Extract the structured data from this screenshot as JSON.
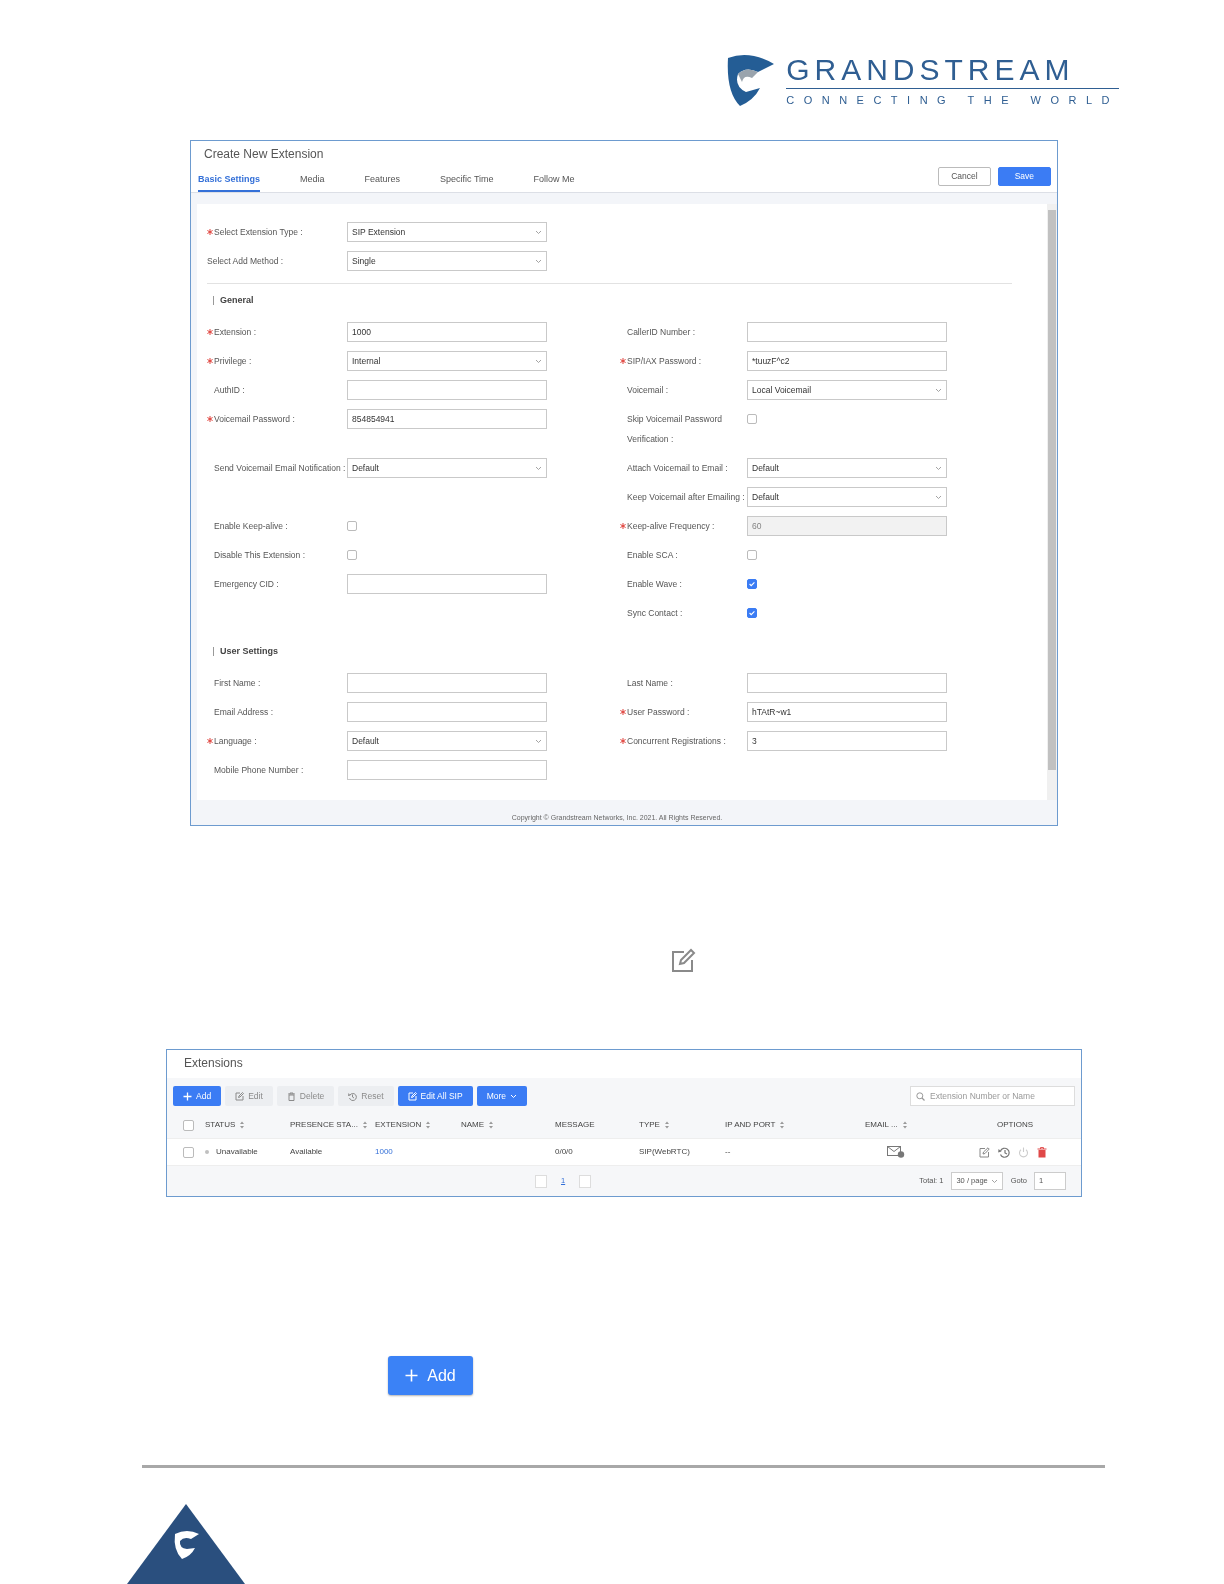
{
  "brand": {
    "name": "GRANDSTREAM",
    "tagline": "CONNECTING THE WORLD"
  },
  "form": {
    "title": "Create New Extension",
    "tabs": [
      {
        "label": "Basic Settings",
        "selected": true
      },
      {
        "label": "Media",
        "selected": false
      },
      {
        "label": "Features",
        "selected": false
      },
      {
        "label": "Specific Time",
        "selected": false
      },
      {
        "label": "Follow Me",
        "selected": false
      }
    ],
    "cancel": "Cancel",
    "save": "Save",
    "top_fields": [
      {
        "label": "Select Extension Type :",
        "required": true,
        "kind": "select",
        "value": "SIP Extension"
      },
      {
        "label": "Select Add Method :",
        "required": false,
        "kind": "select",
        "value": "Single"
      }
    ],
    "sections": [
      {
        "title": "General",
        "rows": [
          [
            {
              "label": "Extension :",
              "required": true,
              "kind": "input",
              "value": "1000"
            },
            {
              "label": "CallerID Number :",
              "required": false,
              "kind": "input"
            }
          ],
          [
            {
              "label": "Privilege :",
              "required": true,
              "kind": "select",
              "value": "Internal"
            },
            {
              "label": "SIP/IAX Password :",
              "required": true,
              "kind": "input",
              "value": "*tuuzF^c2"
            }
          ],
          [
            {
              "label": "AuthID :",
              "required": false,
              "kind": "input"
            },
            {
              "label": "Voicemail :",
              "required": false,
              "kind": "select",
              "value": "Local Voicemail"
            }
          ],
          [
            {
              "label": "Voicemail Password :",
              "required": true,
              "kind": "input",
              "value": "854854941"
            },
            {
              "label": "Skip Voicemail Password Verification :",
              "required": false,
              "kind": "checkbox",
              "checked": false
            }
          ],
          [
            {
              "label": "Send Voicemail Email Notification :",
              "required": false,
              "kind": "select",
              "value": "Default"
            },
            {
              "label": "Attach Voicemail to Email :",
              "required": false,
              "kind": "select",
              "value": "Default"
            }
          ],
          [
            null,
            {
              "label": "Keep Voicemail after Emailing :",
              "required": false,
              "kind": "select",
              "value": "Default"
            }
          ],
          [
            {
              "label": "Enable Keep-alive :",
              "required": false,
              "kind": "checkbox",
              "checked": false
            },
            {
              "label": "Keep-alive Frequency :",
              "required": true,
              "kind": "input",
              "value": "60",
              "disabled": true
            }
          ],
          [
            {
              "label": "Disable This Extension :",
              "required": false,
              "kind": "checkbox",
              "checked": false
            },
            {
              "label": "Enable SCA :",
              "required": false,
              "kind": "checkbox",
              "checked": false
            }
          ],
          [
            {
              "label": "Emergency CID :",
              "required": false,
              "kind": "input"
            },
            {
              "label": "Enable Wave :",
              "required": false,
              "kind": "checkbox",
              "checked": true
            }
          ],
          [
            null,
            {
              "label": "Sync Contact :",
              "required": false,
              "kind": "checkbox",
              "checked": true
            }
          ]
        ]
      },
      {
        "title": "User Settings",
        "rows": [
          [
            {
              "label": "First Name :",
              "required": false,
              "kind": "input"
            },
            {
              "label": "Last Name :",
              "required": false,
              "kind": "input"
            }
          ],
          [
            {
              "label": "Email Address :",
              "required": false,
              "kind": "input"
            },
            {
              "label": "User Password :",
              "required": true,
              "kind": "input",
              "value": "hTAtR~w1"
            }
          ],
          [
            {
              "label": "Language :",
              "required": true,
              "kind": "select",
              "value": "Default"
            },
            {
              "label": "Concurrent Registrations :",
              "required": true,
              "kind": "input",
              "value": "3"
            }
          ],
          [
            {
              "label": "Mobile Phone Number :",
              "required": false,
              "kind": "input"
            },
            null
          ]
        ]
      }
    ],
    "copyright": "Copyright © Grandstream Networks, Inc. 2021. All Rights Reserved."
  },
  "extensions": {
    "title": "Extensions",
    "toolbar": [
      {
        "kind": "add",
        "label": "Add",
        "disabled": false
      },
      {
        "kind": "edit",
        "label": "Edit",
        "disabled": true
      },
      {
        "kind": "delete",
        "label": "Delete",
        "disabled": true
      },
      {
        "kind": "reset",
        "label": "Reset",
        "disabled": true
      },
      {
        "kind": "editall",
        "label": "Edit All SIP",
        "disabled": false
      },
      {
        "kind": "more",
        "label": "More",
        "disabled": false
      }
    ],
    "search": {
      "placeholder": "Extension Number or Name"
    },
    "select_all_checked": false,
    "columns": [
      {
        "label": "STATUS",
        "sortable": true
      },
      {
        "label": "PRESENCE STA...",
        "sortable": true
      },
      {
        "label": "EXTENSION",
        "sortable": true
      },
      {
        "label": "NAME",
        "sortable": true
      },
      {
        "label": "MESSAGE",
        "sortable": false
      },
      {
        "label": "TYPE",
        "sortable": true
      },
      {
        "label": "IP AND PORT",
        "sortable": true
      },
      {
        "label": "EMAIL ...",
        "sortable": true
      },
      {
        "label": "OPTIONS",
        "sortable": false
      }
    ],
    "rows": [
      {
        "checked": false,
        "status": "Unavailable",
        "presence": "Available",
        "extension": "1000",
        "message": "0/0/0",
        "type": "SIP(WebRTC)",
        "ip_port": "--"
      }
    ],
    "pagination": {
      "page": "1",
      "total": "Total: 1",
      "page_size": "30 / page",
      "goto_label": "Goto",
      "goto_value": "1"
    }
  },
  "add_button": {
    "label": "Add"
  }
}
